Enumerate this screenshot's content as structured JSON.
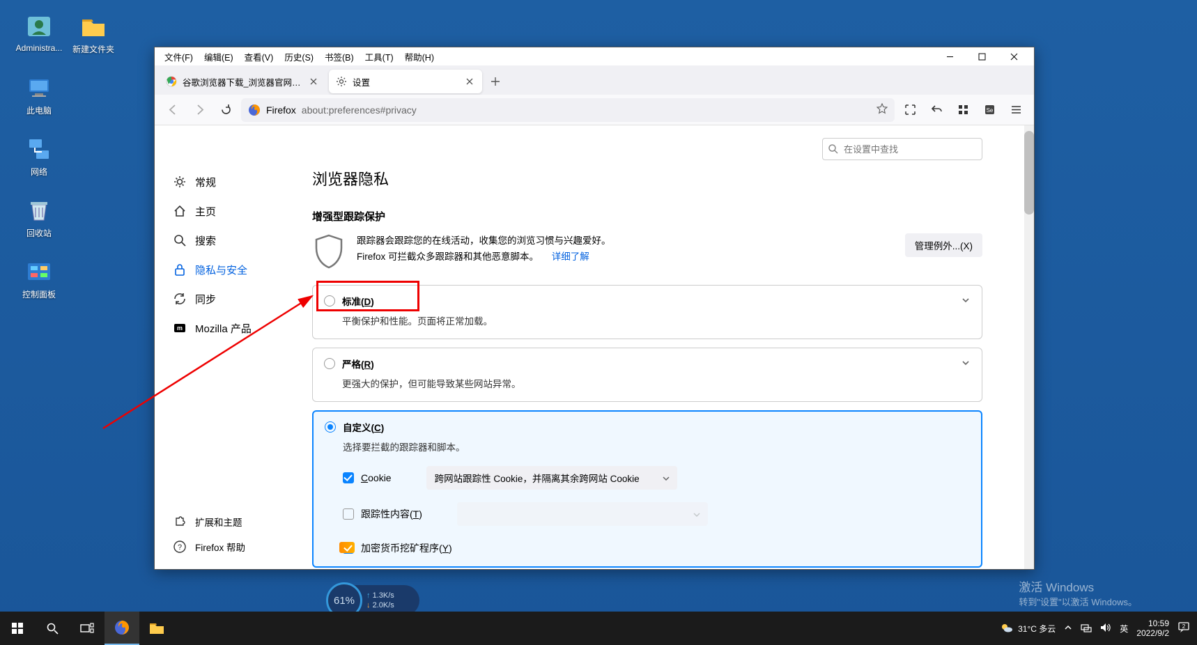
{
  "desktop": {
    "icons": [
      {
        "label": "Administra...",
        "type": "user"
      },
      {
        "label": "新建文件夹",
        "type": "folder"
      },
      {
        "label": "此电脑",
        "type": "pc"
      },
      {
        "label": "网络",
        "type": "network"
      },
      {
        "label": "回收站",
        "type": "trash"
      },
      {
        "label": "控制面板",
        "type": "cpanel"
      }
    ]
  },
  "menubar": {
    "file": "文件(F)",
    "edit": "编辑(E)",
    "view": "查看(V)",
    "history": "历史(S)",
    "bookmarks": "书签(B)",
    "tools": "工具(T)",
    "help": "帮助(H)"
  },
  "tabs": [
    {
      "label": "谷歌浏览器下载_浏览器官网入口",
      "active": false,
      "icon": "chrome"
    },
    {
      "label": "设置",
      "active": true,
      "icon": "gear"
    }
  ],
  "urlbar": {
    "domain": "Firefox",
    "path": "about:preferences#privacy"
  },
  "settings_search_placeholder": "在设置中查找",
  "categories": {
    "general": "常规",
    "home": "主页",
    "search": "搜索",
    "privacy": "隐私与安全",
    "sync": "同步",
    "more": "Mozilla 产品",
    "extensions": "扩展和主题",
    "help": "Firefox 帮助"
  },
  "page": {
    "h1": "浏览器隐私",
    "h2": "增强型跟踪保护",
    "track_line1": "跟踪器会跟踪您的在线活动，收集您的浏览习惯与兴趣爱好。",
    "track_line2_a": "Firefox 可拦截众多跟踪器和其他恶意脚本。",
    "track_line2_b": "详细了解",
    "manage_btn": "管理例外...(X)",
    "standard": {
      "title": "标准(D)",
      "desc": "平衡保护和性能。页面将正常加载。"
    },
    "strict": {
      "title": "严格(R)",
      "desc": "更强大的保护，但可能导致某些网站异常。"
    },
    "custom": {
      "title": "自定义(C)",
      "desc": "选择要拦截的跟踪器和脚本。",
      "cookie_label": "Cookie",
      "cookie_option": "跨网站跟踪性 Cookie，并隔离其余跨网站 Cookie",
      "tracking_label": "跟踪性内容(T)",
      "crypto_label": "加密货币挖矿程序(Y)"
    }
  },
  "watermark": {
    "l1": "激活 Windows",
    "l2": "转到\"设置\"以激活 Windows。"
  },
  "tray": {
    "weather": "31°C 多云",
    "ime": "英",
    "time": "10:59",
    "date": "2022/9/2"
  },
  "pill": {
    "pct": "61%",
    "up": "1.3K/s",
    "down": "2.0K/s"
  }
}
